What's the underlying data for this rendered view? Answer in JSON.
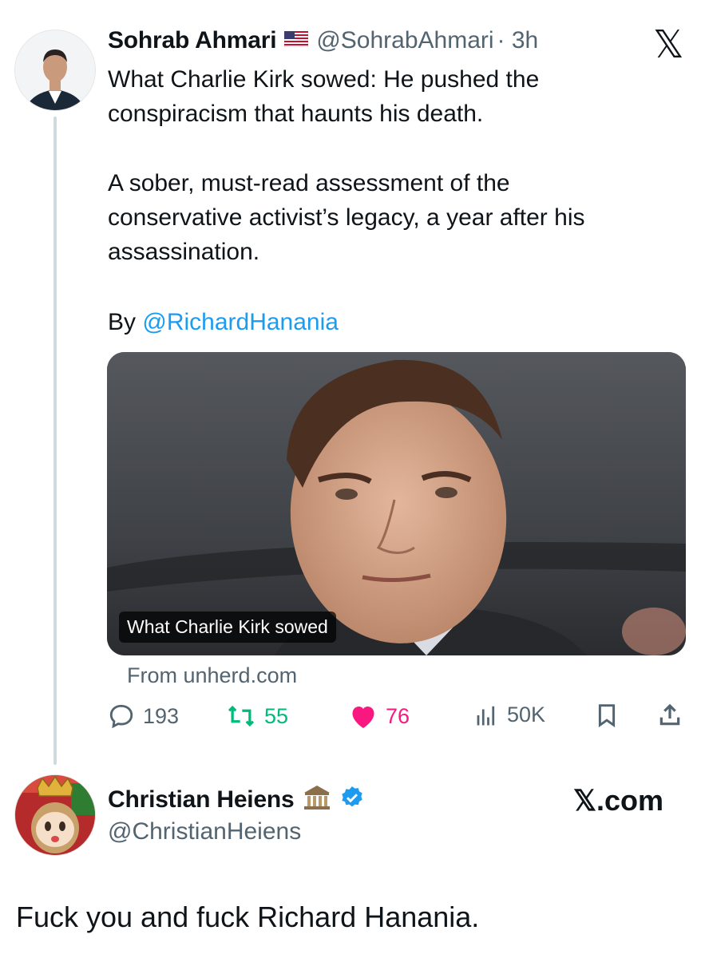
{
  "tweet": {
    "author_name": "Sohrab Ahmari",
    "flag_icon": "us-flag-icon",
    "handle": "@SohrabAhmari",
    "time": "· 3h",
    "text_line1": "What Charlie Kirk sowed: He pushed the",
    "text_line2": "conspiracism that haunts his death.",
    "para2_line1": "A sober, must-read assessment of the",
    "para2_line2": "conservative activist’s legacy, a year after his",
    "para2_line3": "assassination.",
    "by_prefix": "By ",
    "by_link": "@RichardHanania",
    "card": {
      "caption": "What Charlie Kirk sowed",
      "source": "From unherd.com"
    },
    "stats": {
      "replies": "193",
      "reposts": "55",
      "likes": "76",
      "views": "50K"
    },
    "colors": {
      "repost": "#00ba7c",
      "like": "#f91880",
      "link": "#1d9bf0"
    }
  },
  "reply": {
    "author_name": "Christian Heiens",
    "badge_icon": "classical-building-emoji",
    "verified_icon": "verified-badge-icon",
    "handle": "@ChristianHeiens",
    "source_label": "𝕏.com",
    "text": "Fuck you and fuck Richard Hanania."
  },
  "top_right_logo": "𝕏"
}
